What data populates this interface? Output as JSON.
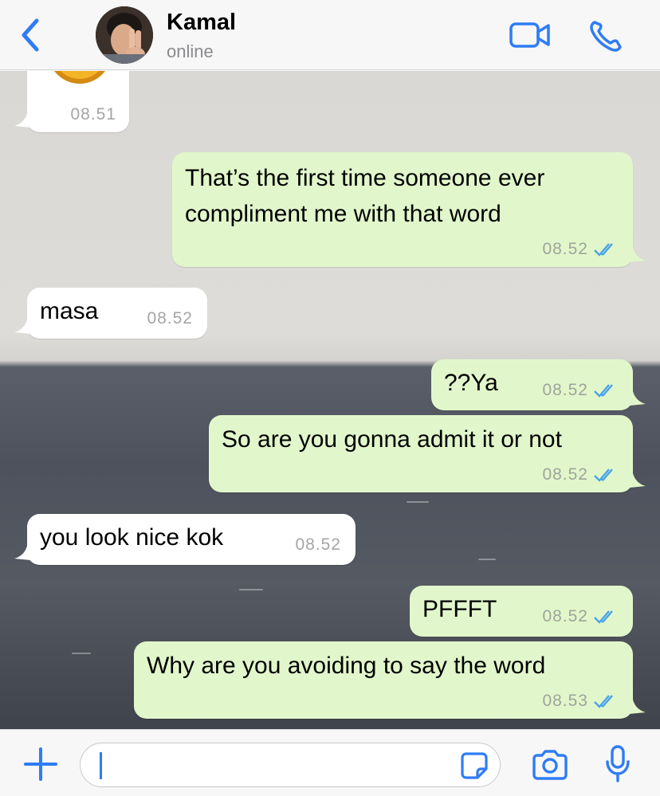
{
  "header": {
    "contact_name": "Kamal",
    "status": "online",
    "accent_color": "#2f7cf6"
  },
  "icons": [
    "chevron-left-icon",
    "video-camera-icon",
    "phone-icon",
    "plus-icon",
    "sticker-icon",
    "camera-icon",
    "microphone-icon",
    "double-check-icon"
  ],
  "messages": [
    {
      "direction": "in",
      "text": "",
      "time": "08.51",
      "note": "emoji sticker partially visible"
    },
    {
      "direction": "out",
      "line1": "That’s the first time someone ever",
      "line2": "compliment me with that word",
      "time": "08.52",
      "read": true
    },
    {
      "direction": "in",
      "text": "masa",
      "time": "08.52"
    },
    {
      "direction": "out",
      "text": "??Ya",
      "time": "08.52",
      "read": true
    },
    {
      "direction": "out",
      "text": "So are you gonna admit it or not",
      "time": "08.52",
      "read": true
    },
    {
      "direction": "in",
      "text": "you look nice kok",
      "time": "08.52"
    },
    {
      "direction": "out",
      "text": "PFFFT",
      "time": "08.52",
      "read": true
    },
    {
      "direction": "out",
      "text": "Why are you avoiding to say the word",
      "time": "08.53",
      "read": true
    }
  ],
  "composer": {
    "value": "",
    "outgoing_bubble_color": "#e1f7cb",
    "incoming_bubble_color": "#ffffff",
    "read_tick_color": "#4aa3e8"
  }
}
